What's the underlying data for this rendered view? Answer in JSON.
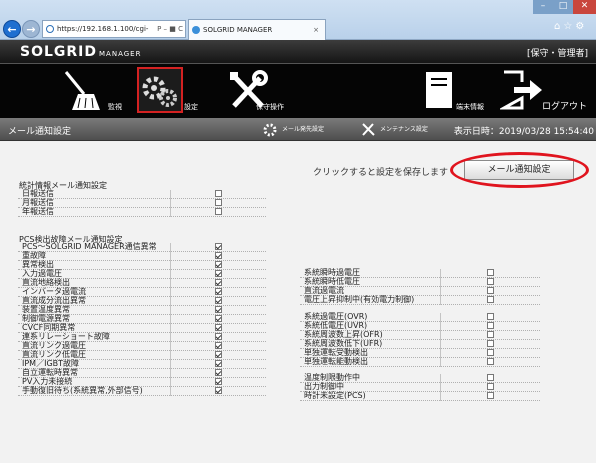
{
  "browser": {
    "address": "https://192.168.1.100/cgi-",
    "address_controls": "Ρ – ■ C",
    "tab_title": "SOLGRID MANAGER",
    "tab_close": "×"
  },
  "header": {
    "logo": "SOLGRID",
    "logo_suffix": "MANAGER",
    "role": "[保守・管理者]"
  },
  "menu": {
    "items": [
      {
        "label": "監視",
        "icon": "broom-icon"
      },
      {
        "label": "設定",
        "icon": "gear-icon"
      },
      {
        "label": "保守操作",
        "icon": "tools-icon"
      },
      {
        "label": "端末情報",
        "icon": "terminal-info-icon"
      },
      {
        "label": "ログアウト",
        "icon": "logout-icon"
      }
    ]
  },
  "subheader": {
    "title": "メール通知設定",
    "link1": "メール発先設定",
    "link2": "メンテナンス設定",
    "datetime": "表示日時：2019/03/28 15:54:40"
  },
  "content": {
    "hint": "クリックすると設定を保存します",
    "save_button": "メール通知設定",
    "stats": {
      "title": "統計情報メール通知設定",
      "rows": [
        {
          "label": "日報送信",
          "checked": false
        },
        {
          "label": "月報送信",
          "checked": false
        },
        {
          "label": "年報送信",
          "checked": false
        }
      ]
    },
    "pcs": {
      "title": "PCS検出故障メール通知設定",
      "left": [
        {
          "label": "PCS〜SOLGRID MANAGER通信異常",
          "checked": true
        },
        {
          "label": "重故障",
          "checked": true
        },
        {
          "label": "異常検出",
          "checked": true
        },
        {
          "label": "入力過電圧",
          "checked": true
        },
        {
          "label": "直流地絡検出",
          "checked": true
        },
        {
          "label": "インバータ過電流",
          "checked": true
        },
        {
          "label": "直流成分流出異常",
          "checked": true
        },
        {
          "label": "装置温度異常",
          "checked": true
        },
        {
          "label": "制御電源異常",
          "checked": true
        },
        {
          "label": "CVCF同期異常",
          "checked": true
        },
        {
          "label": "連系リレーショート故障",
          "checked": true
        },
        {
          "label": "直流リンク過電圧",
          "checked": true
        },
        {
          "label": "直流リンク低電圧",
          "checked": true
        },
        {
          "label": "IPM／IGBT故障",
          "checked": true
        },
        {
          "label": "自立運転時異常",
          "checked": true
        },
        {
          "label": "PV入力未接続",
          "checked": true
        },
        {
          "label": "手動復旧待ち(系統異常,外部信号)",
          "checked": true
        }
      ],
      "right_group1": [
        {
          "label": "系統瞬時過電圧",
          "checked": false
        },
        {
          "label": "系統瞬時低電圧",
          "checked": false
        },
        {
          "label": "直流過電流",
          "checked": false
        },
        {
          "label": "電圧上昇抑制中(有効電力制御)",
          "checked": false
        }
      ],
      "right_group2": [
        {
          "label": "系統過電圧(OVR)",
          "checked": false
        },
        {
          "label": "系統低電圧(UVR)",
          "checked": false
        },
        {
          "label": "系統周波数上昇(OFR)",
          "checked": false
        },
        {
          "label": "系統周波数低下(UFR)",
          "checked": false
        },
        {
          "label": "単独運転受動検出",
          "checked": false
        },
        {
          "label": "単独運転能動検出",
          "checked": false
        }
      ],
      "right_group3": [
        {
          "label": "温度制限動作中",
          "checked": false
        },
        {
          "label": "出力制御中",
          "checked": false
        },
        {
          "label": "時計未設定(PCS)",
          "checked": false
        }
      ]
    }
  }
}
